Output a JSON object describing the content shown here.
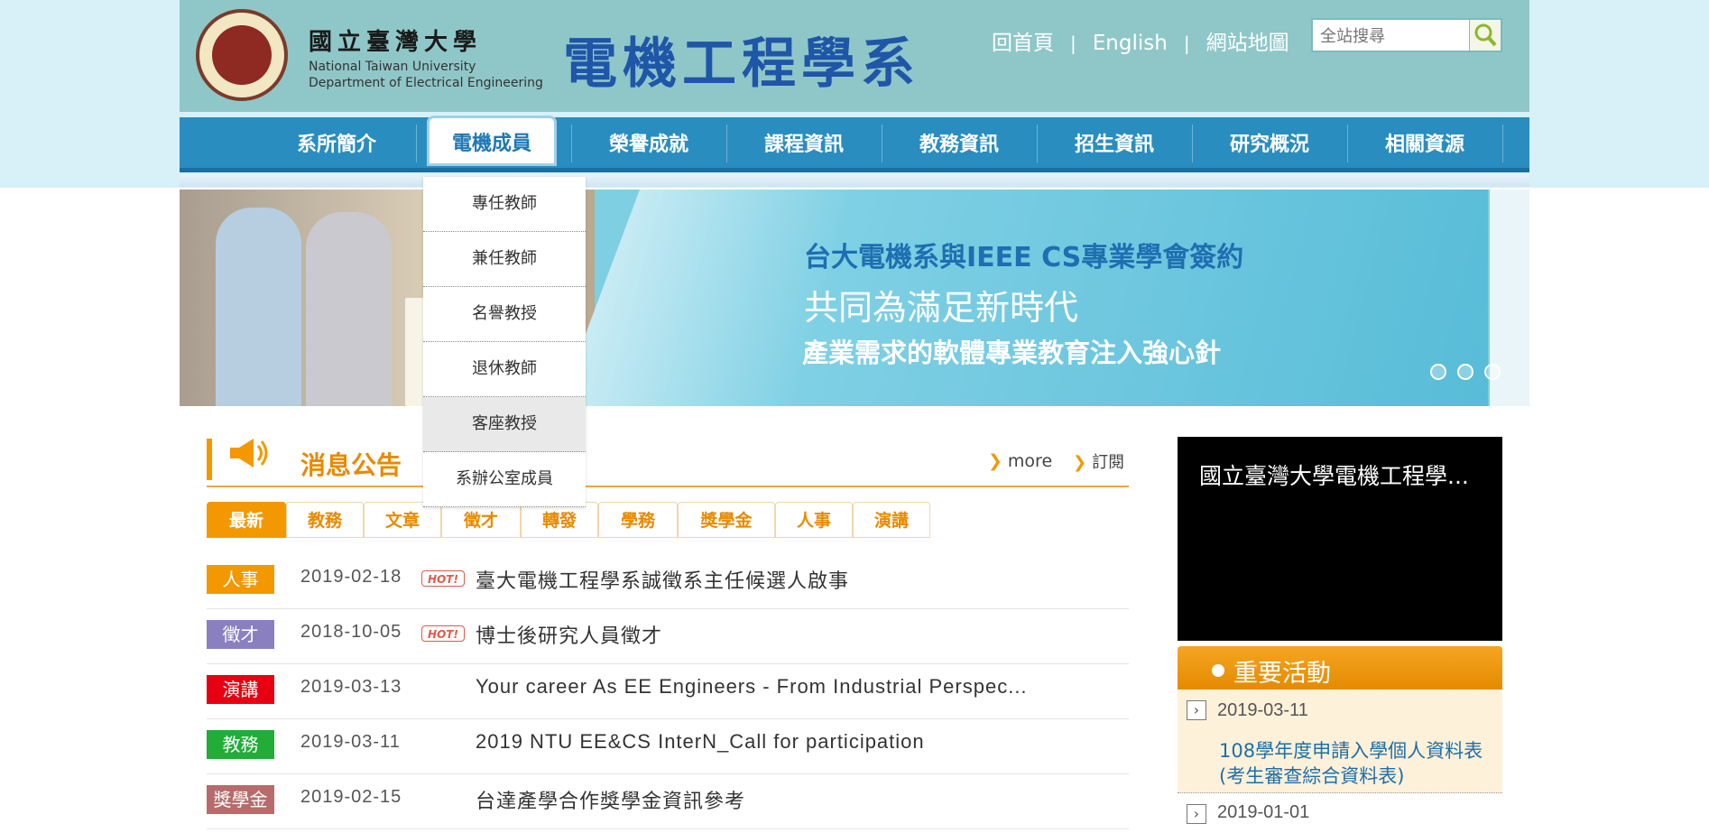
{
  "header": {
    "uni_zh": "國立臺灣大學",
    "uni_en1": "National Taiwan University",
    "uni_en2": "Department of Electrical Engineering",
    "dept_title": "電機工程學系",
    "toplinks": {
      "home": "回首頁",
      "sep1": "|",
      "english": "English",
      "sep2": "|",
      "sitemap": "網站地圖"
    },
    "search_placeholder": "全站搜尋"
  },
  "nav": {
    "items": [
      "系所簡介",
      "電機成員",
      "榮譽成就",
      "課程資訊",
      "教務資訊",
      "招生資訊",
      "研究概況",
      "相關資源"
    ],
    "active_index": 1
  },
  "dropdown": {
    "items": [
      "專任教師",
      "兼任教師",
      "名譽教授",
      "退休教師",
      "客座教授",
      "系辦公室成員"
    ],
    "hover_index": 4
  },
  "banner": {
    "line1": "台大電機系與IEEE  CS專業學會簽約",
    "line2": "共同為滿足新時代",
    "line3": "產業需求的軟體專業教育注入強心針"
  },
  "news": {
    "title": "消息公告",
    "more": "more",
    "subscribe": "訂閱",
    "tabs": [
      "最新",
      "教務",
      "文章",
      "徵才",
      "轉發",
      "學務",
      "獎學金",
      "人事",
      "演講"
    ],
    "active_tab": 0,
    "hot_label": "HOT!",
    "rows": [
      {
        "badge": "人事",
        "color": "#f39800",
        "date": "2019-02-18",
        "hot": true,
        "text": "臺大電機工程學系誠徵系主任候選人啟事"
      },
      {
        "badge": "徵才",
        "color": "#8a80c0",
        "date": "2018-10-05",
        "hot": true,
        "text": "博士後研究人員徵才"
      },
      {
        "badge": "演講",
        "color": "#e60012",
        "date": "2019-03-13",
        "hot": false,
        "text": "Your career As EE Engineers - From Industrial Perspec..."
      },
      {
        "badge": "教務",
        "color": "#22ac38",
        "date": "2019-03-11",
        "hot": false,
        "text": "2019 NTU EE&CS InterN_Call for participation"
      },
      {
        "badge": "獎學金",
        "color": "#b86b6b",
        "date": "2019-02-15",
        "hot": false,
        "text": "台達產學合作獎學金資訊參考"
      }
    ]
  },
  "video": {
    "title": "國立臺灣大學電機工程學..."
  },
  "events": {
    "title": "重要活動",
    "items": [
      {
        "date": "2019-03-11",
        "text": "108學年度申請入學個人資料表(考生審查綜合資料表)"
      },
      {
        "date": "2019-01-01",
        "text": ""
      }
    ]
  },
  "colors": {
    "nav": "#2a8dbf",
    "header": "#8fc7c8",
    "accent": "#f39800"
  }
}
